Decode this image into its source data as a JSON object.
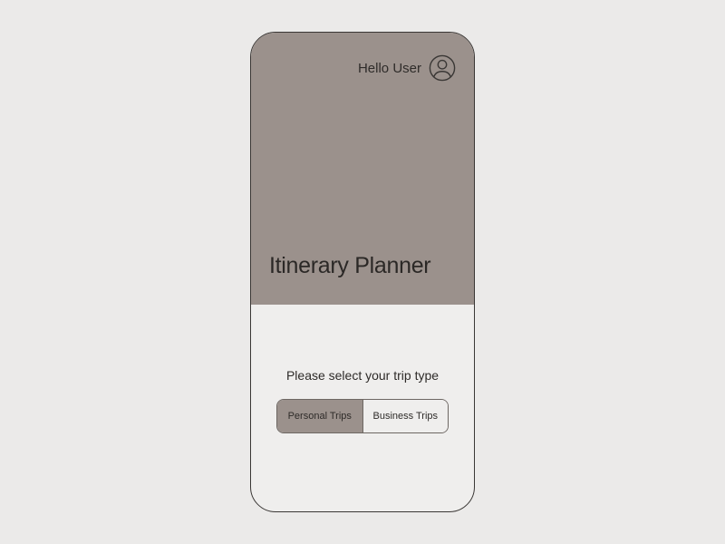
{
  "header": {
    "greeting": "Hello User"
  },
  "hero": {
    "title": "Itinerary Planner"
  },
  "lower": {
    "prompt": "Please select your trip type",
    "segments": {
      "personal": "Personal Trips",
      "business": "Business Trips"
    },
    "selected": "personal"
  },
  "colors": {
    "hero_bg": "#9b918c",
    "page_bg": "#ebeae9",
    "phone_bg": "#efeeed",
    "border": "#3a3735"
  }
}
